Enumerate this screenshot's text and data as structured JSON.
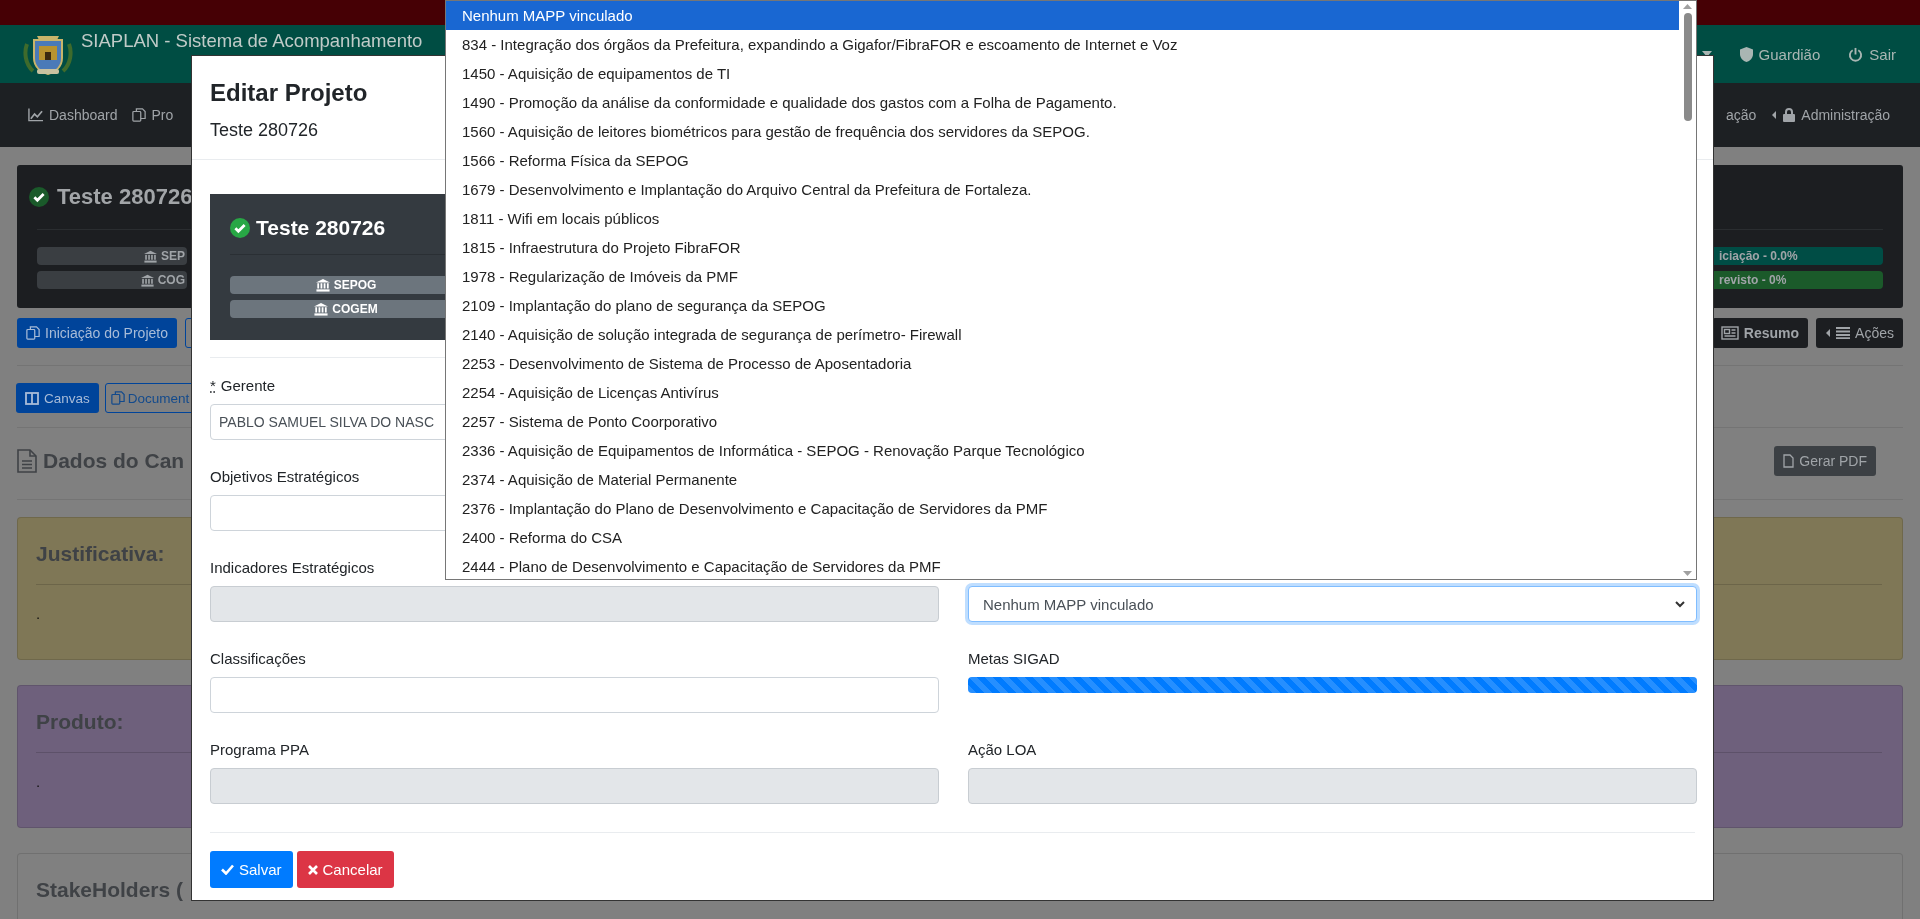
{
  "app_header": {
    "title": "SIAPLAN - Sistema de Acompanhamento",
    "links": [
      "Guardião",
      "Sair"
    ]
  },
  "nav_bar": {
    "items_left": [
      "Dashboard",
      "Pro"
    ],
    "items_right": [
      "ação",
      "Administração"
    ]
  },
  "project_card": {
    "title": "Teste 280726",
    "units": [
      "SEP",
      "COG"
    ],
    "status_badges": [
      {
        "label": "iciação - 0.0%",
        "color": "#004d45"
      },
      {
        "label": "revisto - 0%",
        "color": "#1b5a2a"
      }
    ]
  },
  "project_actions": {
    "left": [
      "Iniciação do Projeto"
    ],
    "right": [
      "Resumo",
      "Ações"
    ]
  },
  "view_tabs": [
    {
      "label": "Canvas",
      "selected": true
    },
    {
      "label": "Document",
      "selected": false
    }
  ],
  "section": {
    "title": "Dados do Can",
    "action": "Gerar PDF"
  },
  "panels": [
    {
      "title": "Justificativa:",
      "text": ".",
      "color": "#7f7756"
    },
    {
      "title": "Produto:",
      "text": ".",
      "color": "#6e607c"
    },
    {
      "title": "StakeHolders (",
      "color": "#808080"
    }
  ],
  "modal": {
    "title": "Editar Projeto",
    "subtitle": "Teste 280726",
    "project_card": {
      "title": "Teste 280726",
      "units": [
        "SEPOG",
        "COGEM"
      ]
    },
    "form_rows": [
      {
        "left": {
          "kind": "input",
          "label": "Gerente",
          "required_mark": "*",
          "value": "PABLO SAMUEL SILVA DO NASC",
          "disabled": false
        }
      },
      {
        "left": {
          "kind": "input",
          "label": "Objetivos Estratégicos",
          "disabled": false
        }
      },
      {
        "left": {
          "kind": "input",
          "label": "Indicadores Estratégicos",
          "disabled": true
        },
        "right": {
          "kind": "select",
          "value": "Nenhum MAPP vinculado",
          "focused": true
        }
      },
      {
        "left": {
          "kind": "input",
          "label": "Classificações",
          "disabled": false
        },
        "right": {
          "kind": "progress",
          "label": "Metas SIGAD",
          "level": 1
        }
      },
      {
        "left": {
          "kind": "input",
          "label": "Programa PPA",
          "disabled": true
        },
        "right": {
          "kind": "input",
          "label": "Ação LOA",
          "disabled": true
        }
      }
    ],
    "buttons": [
      {
        "label": "Salvar",
        "kind": "primary"
      },
      {
        "label": "Cancelar",
        "kind": "danger"
      }
    ],
    "dropdown": {
      "options": [
        {
          "label": "Nenhum MAPP vinculado",
          "selected": true
        },
        {
          "label": "834 - Integração dos órgãos da Prefeitura, expandindo a Gigafor/FibraFOR e escoamento de Internet e Voz",
          "selected": false
        },
        {
          "label": "1450 - Aquisição de equipamentos de TI",
          "selected": false
        },
        {
          "label": "1490 - Promoção da análise da conformidade e qualidade dos gastos com a Folha de Pagamento.",
          "selected": false
        },
        {
          "label": "1560 - Aquisição de leitores biométricos para gestão de frequência dos servidores da SEPOG.",
          "selected": false
        },
        {
          "label": "1566 - Reforma Física da SEPOG",
          "selected": false
        },
        {
          "label": "1679 - Desenvolvimento e Implantação do Arquivo Central da Prefeitura de Fortaleza.",
          "selected": false
        },
        {
          "label": "1811 - Wifi em locais públicos",
          "selected": false
        },
        {
          "label": "1815 - Infraestrutura do Projeto FibraFOR",
          "selected": false
        },
        {
          "label": "1978 - Regularização de Imóveis da PMF",
          "selected": false
        },
        {
          "label": "2109 - Implantação do plano de segurança da SEPOG",
          "selected": false
        },
        {
          "label": "2140 - Aquisição de solução integrada de segurança de perímetro- Firewall",
          "selected": false
        },
        {
          "label": "2253 - Desenvolvimento de Sistema de Processo de Aposentadoria",
          "selected": false
        },
        {
          "label": "2254 - Aquisição de Licenças Antivírus",
          "selected": false
        },
        {
          "label": "2257 - Sistema de Ponto Coorporativo",
          "selected": false
        },
        {
          "label": "2336 - Aquisição de Equipamentos de Informática - SEPOG - Renovação Parque Tecnológico",
          "selected": false
        },
        {
          "label": "2374 - Aquisição de Material Permanente",
          "selected": false
        },
        {
          "label": "2376 - Implantação do Plano de Desenvolvimento e Capacitação de Servidores da PMF",
          "selected": false
        },
        {
          "label": "2400 - Reforma do CSA",
          "selected": false
        },
        {
          "label": "2444 - Plano de Desenvolvimento e Capacitação de Servidores da PMF",
          "selected": false
        }
      ]
    }
  }
}
